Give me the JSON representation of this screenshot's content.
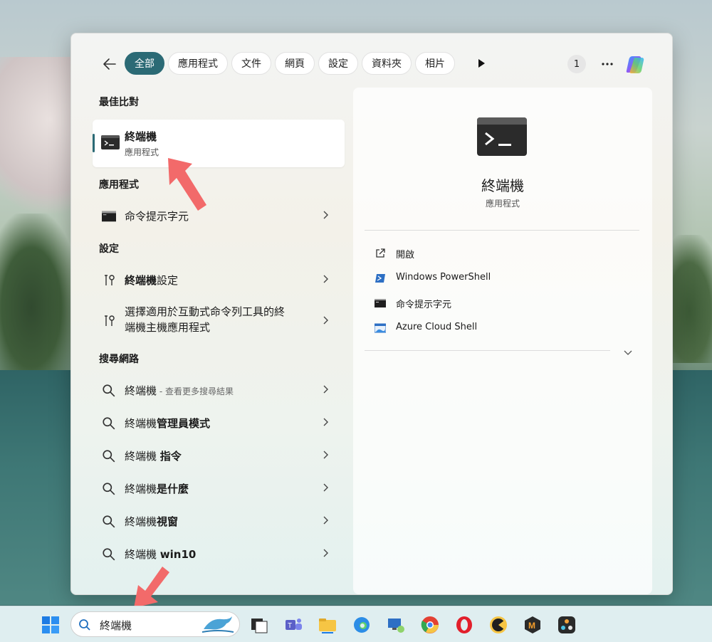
{
  "filters": {
    "chips": [
      "全部",
      "應用程式",
      "文件",
      "網頁",
      "設定",
      "資料夾",
      "相片"
    ],
    "badge": "1"
  },
  "sections": {
    "best_match": "最佳比對",
    "apps": "應用程式",
    "settings": "設定",
    "web": "搜尋網路"
  },
  "best_match": {
    "title": "終端機",
    "subtitle": "應用程式"
  },
  "apps": [
    {
      "label": "命令提示字元"
    }
  ],
  "settings": [
    {
      "prefix": "終端機",
      "suffix": "設定"
    },
    {
      "line1": "選擇適用於互動式命令列工具的終",
      "line2": "端機主機應用程式"
    }
  ],
  "web": [
    {
      "prefix": "終端機",
      "suffix": "",
      "sub": " - 查看更多搜尋結果"
    },
    {
      "prefix": "終端機",
      "suffix": "管理員模式",
      "sub": ""
    },
    {
      "prefix": "終端機 ",
      "suffix": "指令",
      "sub": ""
    },
    {
      "prefix": "終端機",
      "suffix": "是什麼",
      "sub": ""
    },
    {
      "prefix": "終端機",
      "suffix": "視窗",
      "sub": ""
    },
    {
      "prefix": "終端機 ",
      "suffix": "win10",
      "sub": ""
    }
  ],
  "preview": {
    "title": "終端機",
    "subtitle": "應用程式",
    "actions": [
      "開啟",
      "Windows PowerShell",
      "命令提示字元",
      "Azure Cloud Shell"
    ]
  },
  "taskbar": {
    "search_text": "終端機"
  },
  "colors": {
    "accent": "#2b6a75",
    "arrow": "#f26a6a"
  }
}
